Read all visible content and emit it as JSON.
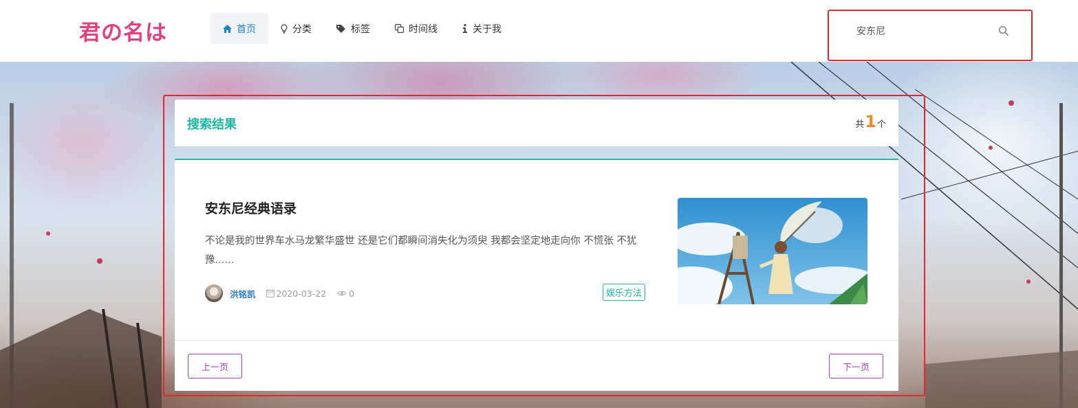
{
  "site": {
    "logo": "君の名は"
  },
  "nav": {
    "items": [
      {
        "label": "首页",
        "icon": "home-icon",
        "active": true
      },
      {
        "label": "分类",
        "icon": "lightbulb-icon",
        "active": false
      },
      {
        "label": "标签",
        "icon": "tag-icon",
        "active": false
      },
      {
        "label": "时间线",
        "icon": "copy-icon",
        "active": false
      },
      {
        "label": "关于我",
        "icon": "info-icon",
        "active": false
      }
    ]
  },
  "search": {
    "value": "安东尼",
    "icon": "search-icon"
  },
  "results": {
    "title": "搜索结果",
    "count_prefix": "共",
    "count": "1",
    "count_suffix": "个",
    "posts": [
      {
        "title": "安东尼经典语录",
        "excerpt": "不论是我的世界车水马龙繁华盛世 还是它们都瞬间消失化为须臾 我都会坚定地走向你 不慌张 不犹豫......",
        "author": "洪铭凯",
        "date": "2020-03-22",
        "views": "0",
        "tag": "娱乐方法"
      }
    ]
  },
  "pagination": {
    "prev": "上一页",
    "next": "下一页"
  },
  "colors": {
    "logo": "#e0407e",
    "accent": "#1bb6a5",
    "count": "#f08a24",
    "author": "#2a7ec9",
    "pager": "#a03bbd",
    "highlight": "#e8232a"
  }
}
